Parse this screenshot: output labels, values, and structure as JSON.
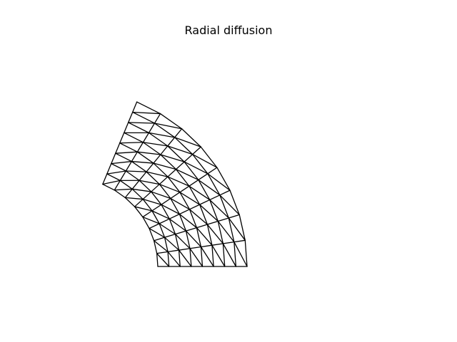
{
  "figure": {
    "title": "Radial diffusion",
    "mesh_color": "#000000",
    "background_color": "#ffffff"
  },
  "mesh": {
    "type": "triangulated annular sector",
    "radial_divisions": 8,
    "angular_divisions": 8,
    "inner_radius": 1.0,
    "outer_radius": 2.0,
    "angle_range_deg": [
      0,
      67.5
    ]
  }
}
